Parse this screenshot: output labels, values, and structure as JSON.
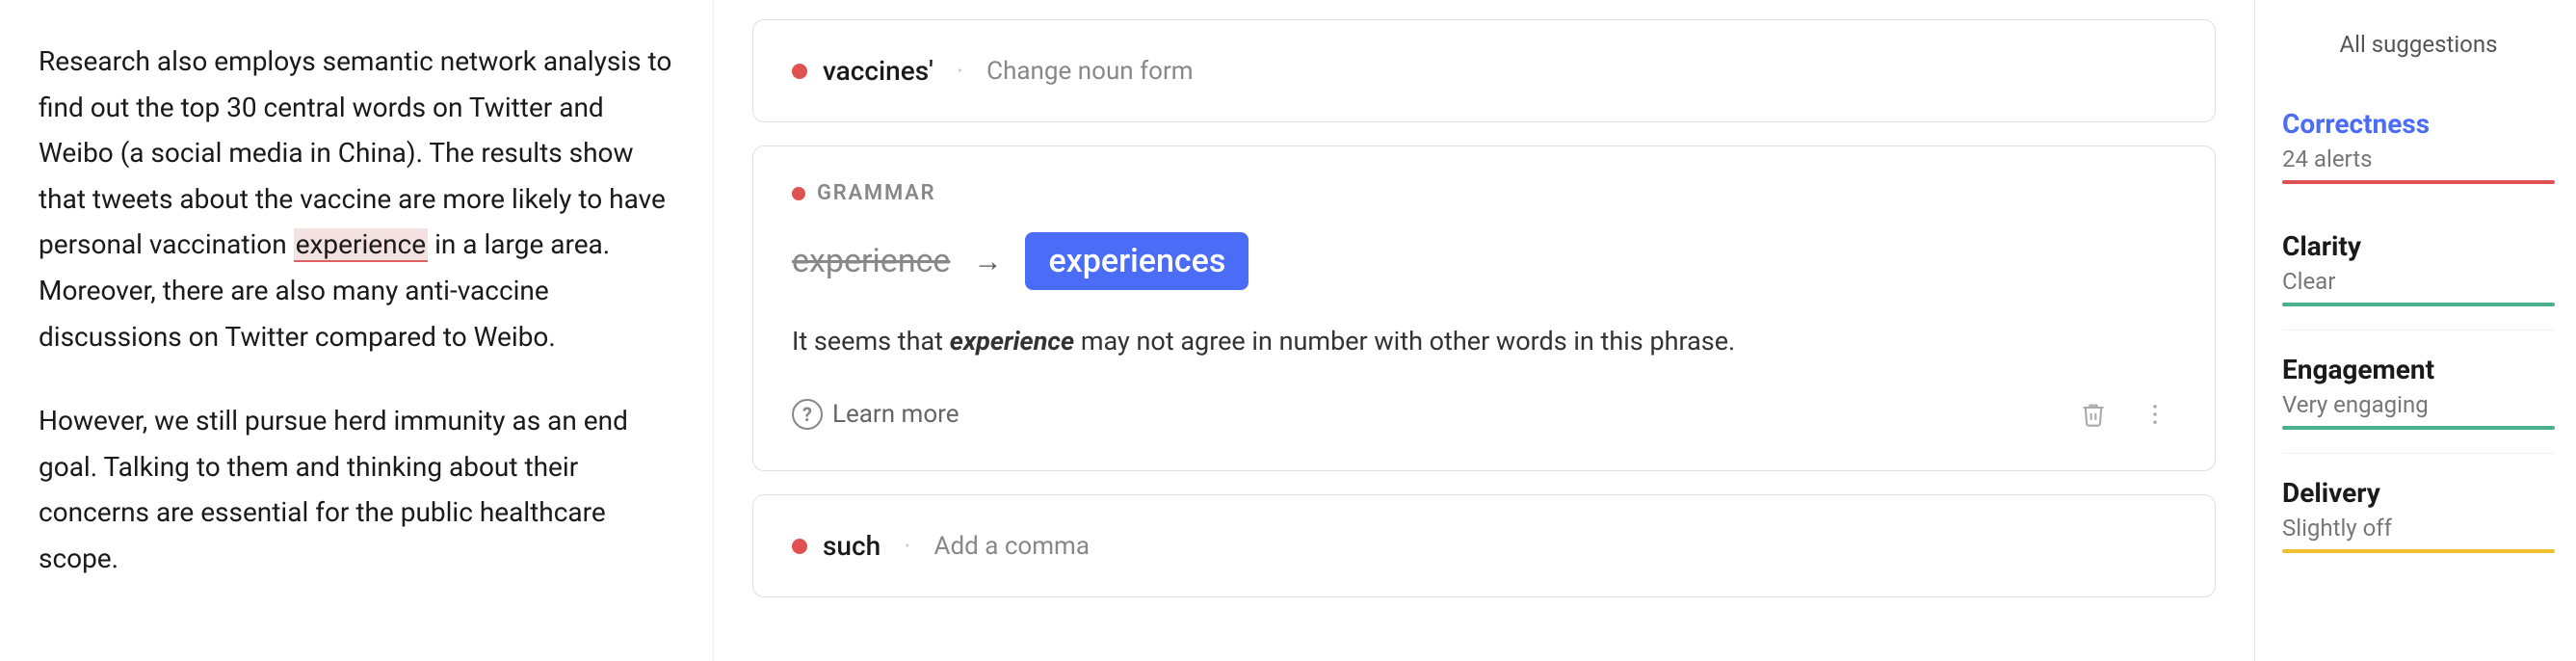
{
  "editor": {
    "paragraph1": "Research also employs semantic network analysis to find out the top 30 central words on Twitter and Weibo (a social media in China). The results show that tweets about the vaccine are more likely to have personal vaccination",
    "highlighted": "experience",
    "paragraph1_end": "in a large area. Moreover, there are also many anti-vaccine discussions on Twitter compared to Weibo.",
    "paragraph2": "However, we still pursue herd immunity as an end goal. Talking to them and thinking about their concerns are essential for the public healthcare scope."
  },
  "suggestions": [
    {
      "type": "simple",
      "word": "vaccines'",
      "action": "Change noun form"
    },
    {
      "type": "grammar",
      "label": "GRAMMAR",
      "original": "experience",
      "corrected": "experiences",
      "description_pre": "It seems that ",
      "description_bold": "experience",
      "description_post": " may not agree in number with other words in this phrase.",
      "learn_more": "Learn more"
    },
    {
      "type": "simple",
      "word": "such",
      "action": "Add a comma"
    }
  ],
  "sidebar": {
    "title": "All suggestions",
    "items": [
      {
        "name": "Correctness",
        "value": "24 alerts",
        "status": "active",
        "bar": "red"
      },
      {
        "name": "Clarity",
        "value": "Clear",
        "status": "clarity",
        "bar": "green"
      },
      {
        "name": "Engagement",
        "value": "Very engaging",
        "status": "engagement",
        "bar": "green"
      },
      {
        "name": "Delivery",
        "value": "Slightly off",
        "status": "delivery",
        "bar": "yellow"
      }
    ]
  }
}
